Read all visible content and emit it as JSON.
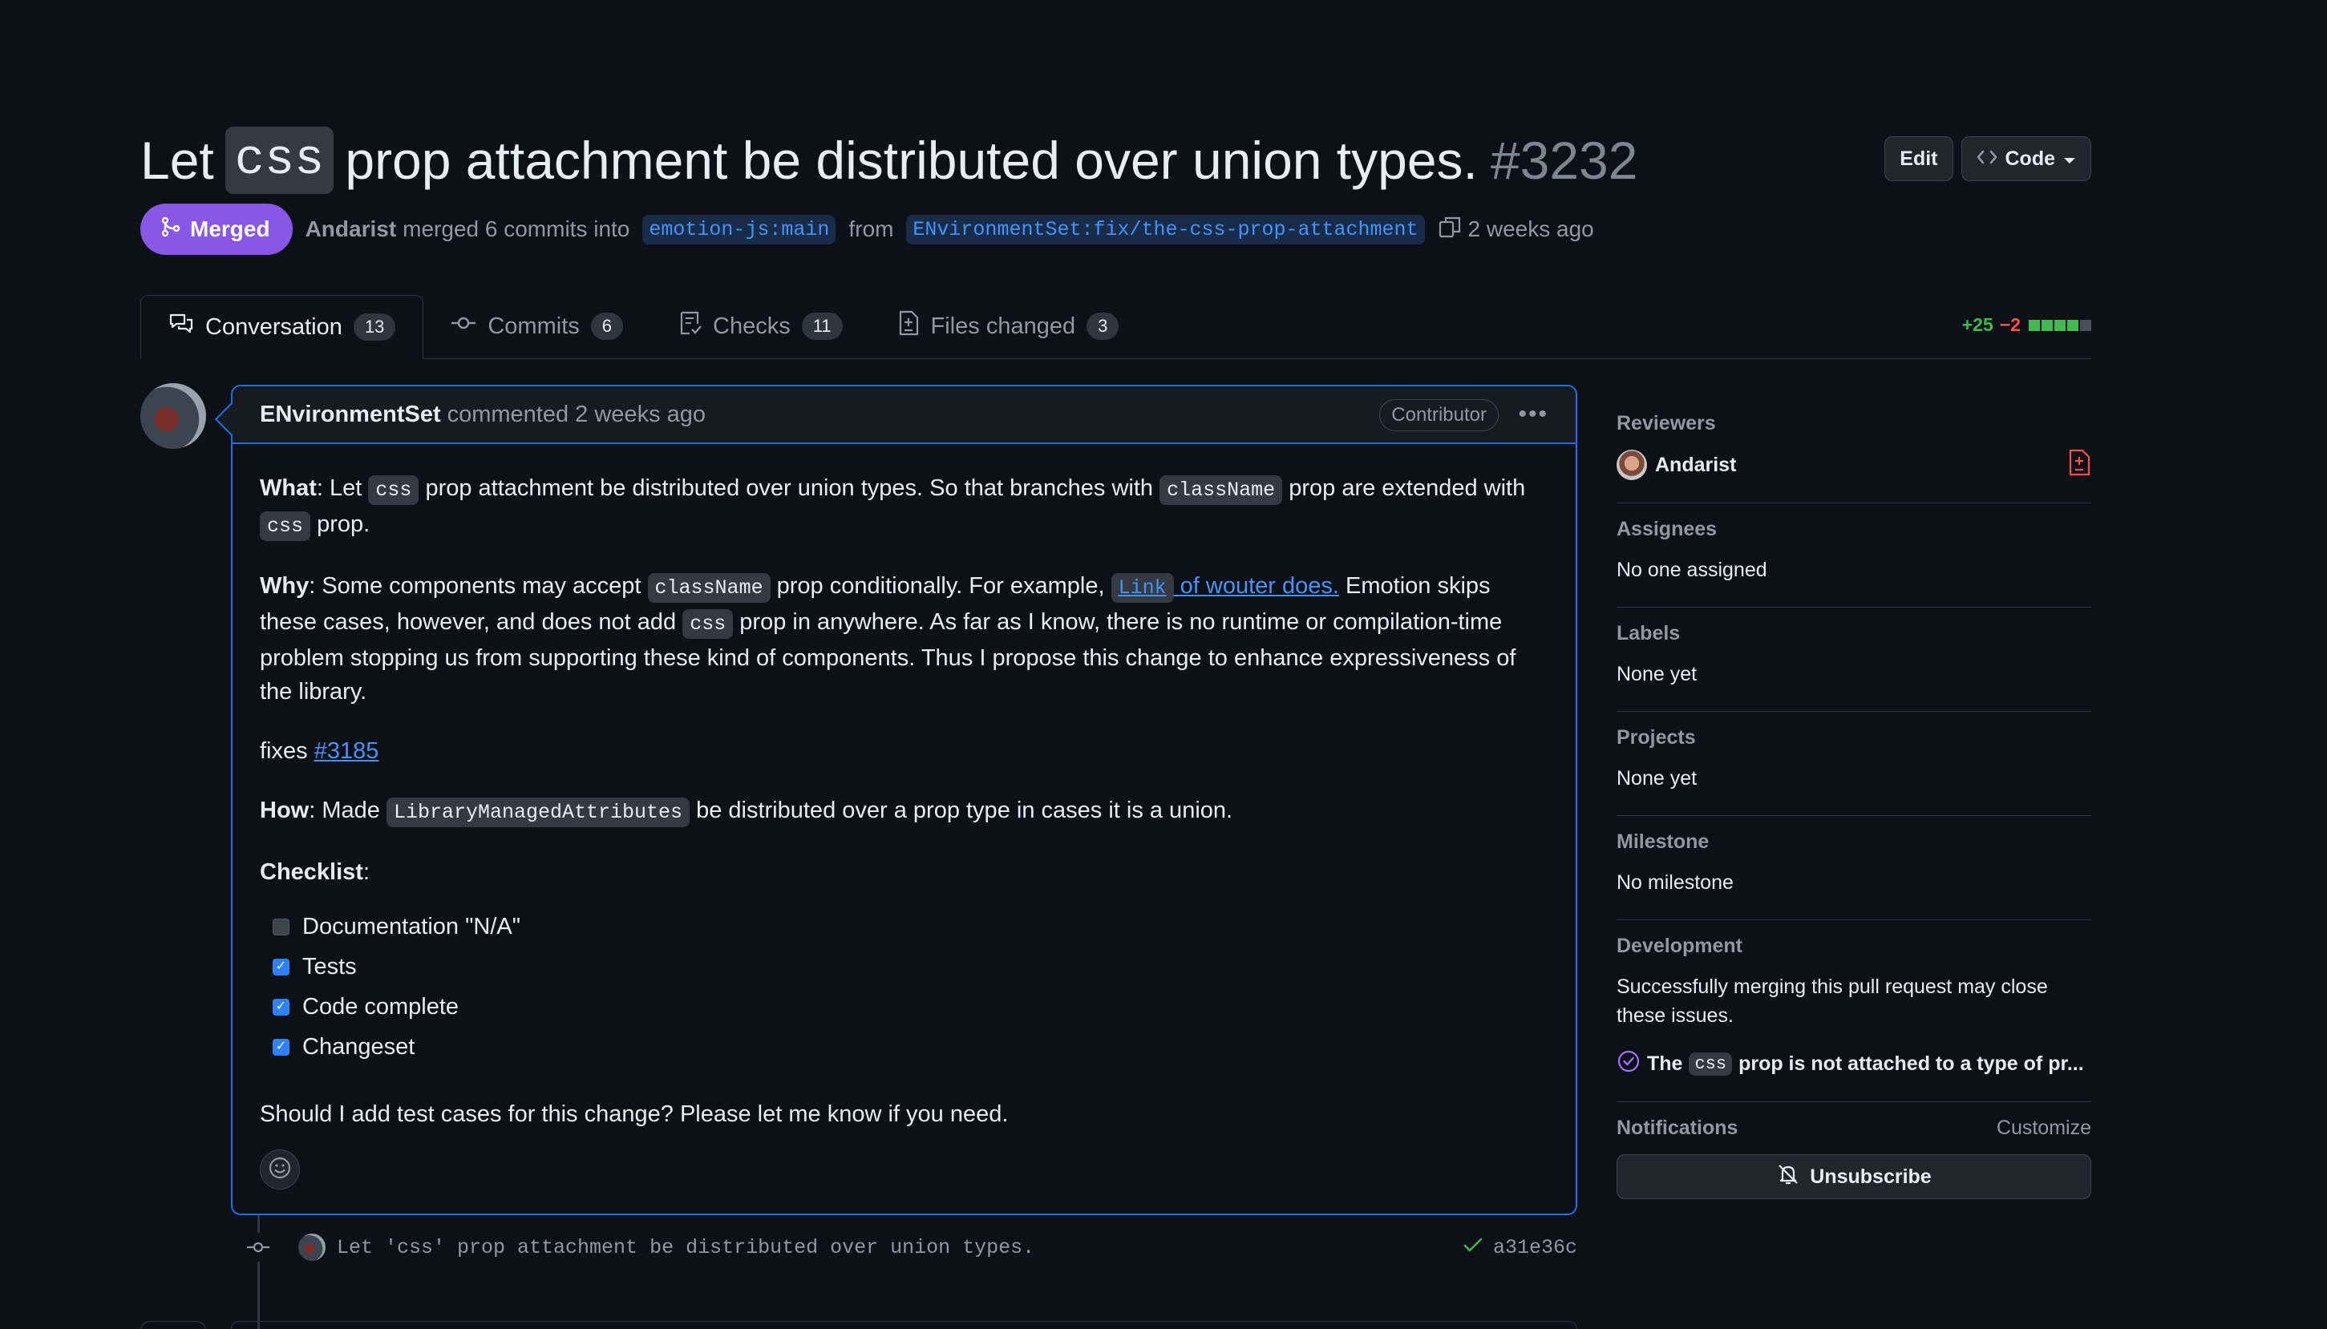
{
  "header": {
    "title_prefix": "Let",
    "title_code": "css",
    "title_suffix": "prop attachment be distributed over union types.",
    "pr_number": "#3232",
    "edit_label": "Edit",
    "code_label": "Code"
  },
  "meta": {
    "status": "Merged",
    "author": "Andarist",
    "action_text": "merged 6 commits into",
    "base_branch": "emotion-js:main",
    "from_text": "from",
    "head_branch": "ENvironmentSet:fix/the-css-prop-attachment",
    "time": "2 weeks ago"
  },
  "tabs": [
    {
      "label": "Conversation",
      "count": "13"
    },
    {
      "label": "Commits",
      "count": "6"
    },
    {
      "label": "Checks",
      "count": "11"
    },
    {
      "label": "Files changed",
      "count": "3"
    }
  ],
  "diffstat": {
    "additions": "+25",
    "deletions": "−2",
    "colors": [
      "#3fb950",
      "#3fb950",
      "#3fb950",
      "#3fb950",
      "#484f58"
    ]
  },
  "comment": {
    "author": "ENvironmentSet",
    "meta": "commented 2 weeks ago",
    "badge": "Contributor",
    "what_label": "What",
    "what_1": ": Let",
    "what_code_1": "css",
    "what_2": "prop attachment be distributed over union types. So that branches with",
    "what_code_2": "className",
    "what_3": "prop are extended with",
    "what_code_3": "css",
    "what_4": "prop.",
    "why_label": "Why",
    "why_1": ": Some components may accept",
    "why_code_1": "className",
    "why_2": "prop conditionally. For example,",
    "why_link_code": "Link",
    "why_link_text": "of wouter does.",
    "why_3": "Emotion skips these cases, however, and does not add",
    "why_code_2": "css",
    "why_4": "prop in anywhere. As far as I know, there is no runtime or compilation-time problem stopping us from supporting these kind of components. Thus I propose this change to enhance expressiveness of the library.",
    "fixes_text": "fixes",
    "fixes_link": "#3185",
    "how_label": "How",
    "how_1": ": Made",
    "how_code": "LibraryManagedAttributes",
    "how_2": "be distributed over a prop type in cases it is a union.",
    "checklist_label": "Checklist",
    "checklist_colon": ":",
    "checklist": [
      {
        "label": "Documentation \"N/A\"",
        "checked": false
      },
      {
        "label": "Tests",
        "checked": true
      },
      {
        "label": "Code complete",
        "checked": true
      },
      {
        "label": "Changeset",
        "checked": true
      }
    ],
    "closing": "Should I add test cases for this change? Please let me know if you need."
  },
  "commit": {
    "message": "Let 'css' prop attachment be distributed over union types.",
    "sha": "a31e36c"
  },
  "sidebar": {
    "reviewers_title": "Reviewers",
    "reviewer": "Andarist",
    "assignees_title": "Assignees",
    "assignees_value": "No one assigned",
    "labels_title": "Labels",
    "labels_value": "None yet",
    "projects_title": "Projects",
    "projects_value": "None yet",
    "milestone_title": "Milestone",
    "milestone_value": "No milestone",
    "development_title": "Development",
    "development_value": "Successfully merging this pull request may close these issues.",
    "issue_pre": "The",
    "issue_code": "css",
    "issue_post": "prop is not attached to a type of pr...",
    "notifications_title": "Notifications",
    "customize_label": "Customize",
    "unsubscribe_label": "Unsubscribe"
  }
}
